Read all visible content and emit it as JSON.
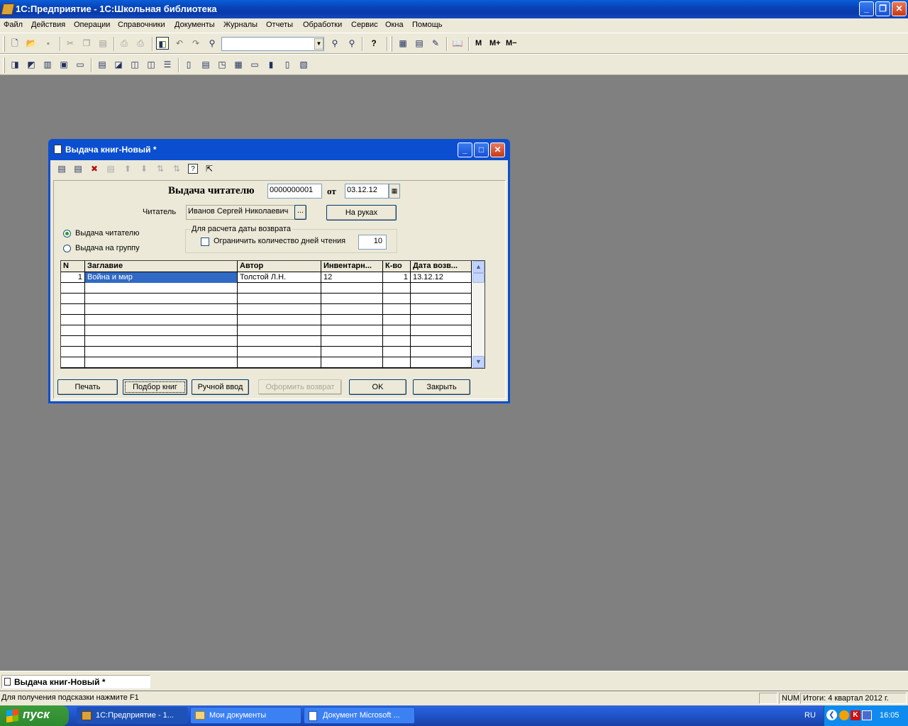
{
  "app": {
    "title": "1С:Предприятие - 1С:Школьная библиотека",
    "caption_buttons": {
      "minimize": "_",
      "restore": "❐",
      "close": "✕"
    }
  },
  "menu": [
    "Файл",
    "Действия",
    "Операции",
    "Справочники",
    "Документы",
    "Журналы",
    "Отчеты",
    "Обработки",
    "Сервис",
    "Окна",
    "Помощь"
  ],
  "toolbar": {
    "search_value": "",
    "icons_row1": [
      "new-icon",
      "open-icon",
      "save-icon",
      "cut-icon",
      "copy-icon",
      "paste-icon",
      "print-icon",
      "print-preview-icon",
      "object-icon",
      "undo-icon",
      "redo-icon",
      "find-icon",
      "find-next-icon",
      "find-prev-icon",
      "help-icon",
      "calculator-icon",
      "calendar-icon",
      "edit-icon",
      "book-icon"
    ],
    "mem_labels": [
      "M",
      "M+",
      "M−"
    ],
    "icons_row2_count": 19
  },
  "dialog": {
    "title": "Выдача книг-Новый *",
    "caption_buttons": {
      "minimize": "_",
      "maximize": "□",
      "close": "✕"
    },
    "heading": "Выдача читателю",
    "number": "0000000001",
    "from_label": "от",
    "date": "03.12.12",
    "reader_label": "Читатель",
    "reader_value": "Иванов Сергей Николаевич",
    "ellipsis": "...",
    "on_hands_button": "На руках",
    "radio_reader": "Выдача читателю",
    "radio_group": "Выдача на группу",
    "return_group_title": "Для расчета  даты возврата",
    "limit_label": "Ограничить  количество дней чтения",
    "days_value": "10",
    "grid": {
      "columns": [
        "N",
        "Заглавие",
        "Автор",
        "Инвентарн...",
        "К-во",
        "Дата возв..."
      ],
      "rows": [
        {
          "n": "1",
          "title": "Война и мир",
          "author": "Толстой Л.Н.",
          "inv": "12",
          "qty": "1",
          "date": "13.12.12"
        }
      ]
    },
    "buttons": {
      "print": "Печать",
      "select_books": "Подбор книг",
      "manual": "Ручной ввод",
      "return": "Оформить возврат",
      "ok": "OK",
      "close": "Закрыть"
    }
  },
  "mdi_tab": "Выдача книг-Новый *",
  "status": {
    "hint": "Для получения подсказки нажмите F1",
    "num": "NUM",
    "totals": "Итоги: 4 квартал 2012 г."
  },
  "taskbar": {
    "start": "пуск",
    "tasks": [
      "1С:Предприятие - 1...",
      "Мои документы",
      "Документ Microsoft ..."
    ],
    "lang": "RU",
    "clock": "16:05"
  }
}
